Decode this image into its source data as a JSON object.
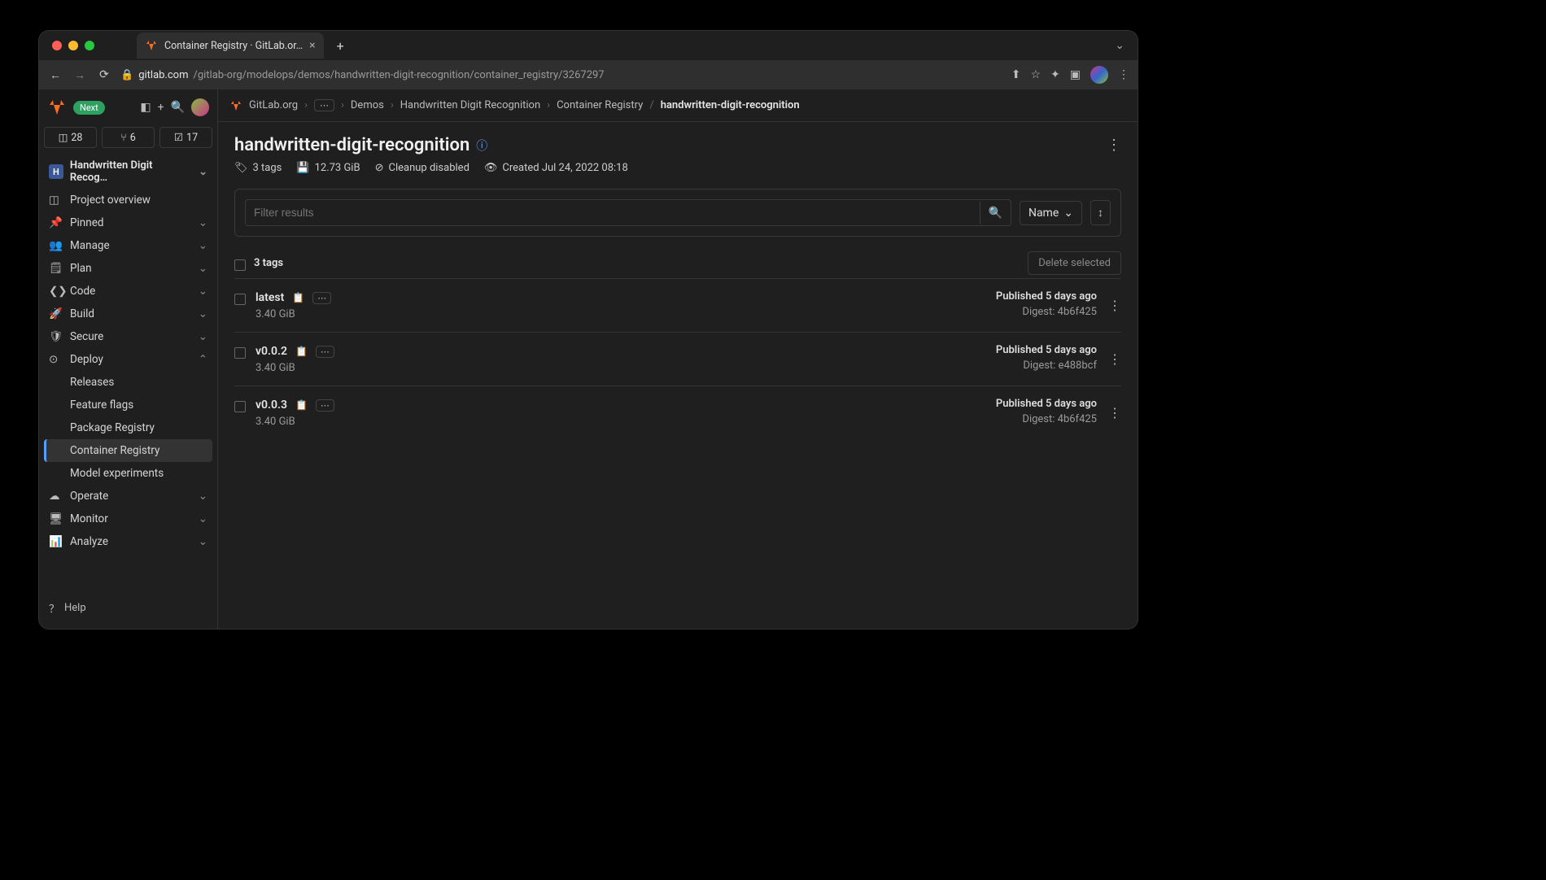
{
  "browser": {
    "tab_title": "Container Registry · GitLab.or…",
    "url_host": "gitlab.com",
    "url_path": "/gitlab-org/modelops/demos/handwritten-digit-recognition/container_registry/3267297"
  },
  "side": {
    "next_label": "Next",
    "stats": {
      "issues": "28",
      "mrs": "6",
      "todos": "17"
    },
    "project_letter": "H",
    "project_name": "Handwritten Digit Recog…",
    "items": [
      {
        "label": "Project overview"
      },
      {
        "label": "Pinned"
      },
      {
        "label": "Manage"
      },
      {
        "label": "Plan"
      },
      {
        "label": "Code"
      },
      {
        "label": "Build"
      },
      {
        "label": "Secure"
      },
      {
        "label": "Deploy"
      },
      {
        "label": "Operate"
      },
      {
        "label": "Monitor"
      },
      {
        "label": "Analyze"
      }
    ],
    "deploy_sub": [
      {
        "label": "Releases"
      },
      {
        "label": "Feature flags"
      },
      {
        "label": "Package Registry"
      },
      {
        "label": "Container Registry"
      },
      {
        "label": "Model experiments"
      }
    ],
    "help": "Help"
  },
  "crumbs": {
    "root": "GitLab.org",
    "a": "Demos",
    "b": "Handwritten Digit Recognition",
    "c": "Container Registry",
    "d": "handwritten-digit-recognition"
  },
  "page": {
    "title": "handwritten-digit-recognition",
    "tags_count": "3 tags",
    "size": "12.73 GiB",
    "cleanup": "Cleanup disabled",
    "created": "Created Jul 24, 2022 08:18",
    "filter_placeholder": "Filter results",
    "sort_label": "Name",
    "list_count": "3 tags",
    "delete_label": "Delete selected"
  },
  "tags": [
    {
      "name": "latest",
      "size": "3.40 GiB",
      "published": "Published 5 days ago",
      "digest": "Digest: 4b6f425"
    },
    {
      "name": "v0.0.2",
      "size": "3.40 GiB",
      "published": "Published 5 days ago",
      "digest": "Digest: e488bcf"
    },
    {
      "name": "v0.0.3",
      "size": "3.40 GiB",
      "published": "Published 5 days ago",
      "digest": "Digest: 4b6f425"
    }
  ]
}
